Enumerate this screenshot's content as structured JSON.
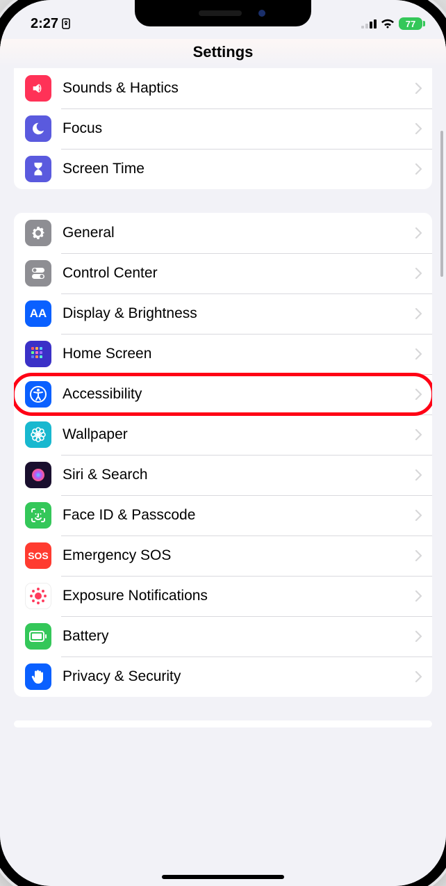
{
  "status": {
    "time": "2:27",
    "battery": "77"
  },
  "header": {
    "title": "Settings"
  },
  "group1": {
    "items": [
      {
        "label": "Sounds & Haptics",
        "iconName": "sound-icon",
        "bg": "#ff3257"
      },
      {
        "label": "Focus",
        "iconName": "moon-icon",
        "bg": "#5a5ade"
      },
      {
        "label": "Screen Time",
        "iconName": "hourglass-icon",
        "bg": "#5a5ade"
      }
    ]
  },
  "group2": {
    "items": [
      {
        "label": "General",
        "iconName": "gear-icon",
        "bg": "#8e8e93"
      },
      {
        "label": "Control Center",
        "iconName": "toggles-icon",
        "bg": "#8e8e93"
      },
      {
        "label": "Display & Brightness",
        "iconName": "aa-icon",
        "bg": "#0a60ff"
      },
      {
        "label": "Home Screen",
        "iconName": "grid-icon",
        "bg": "#3b31c7"
      },
      {
        "label": "Accessibility",
        "iconName": "accessibility-icon",
        "bg": "#0a60ff",
        "highlighted": true
      },
      {
        "label": "Wallpaper",
        "iconName": "flower-icon",
        "bg": "#18b8cf"
      },
      {
        "label": "Siri & Search",
        "iconName": "siri-icon",
        "bg": "#000"
      },
      {
        "label": "Face ID & Passcode",
        "iconName": "face-icon",
        "bg": "#34c759"
      },
      {
        "label": "Emergency SOS",
        "iconName": "sos-icon",
        "bg": "#ff3b30"
      },
      {
        "label": "Exposure Notifications",
        "iconName": "exposure-icon",
        "bg": "#fff"
      },
      {
        "label": "Battery",
        "iconName": "battery-icon",
        "bg": "#34c759"
      },
      {
        "label": "Privacy & Security",
        "iconName": "hand-icon",
        "bg": "#0a60ff"
      }
    ]
  }
}
